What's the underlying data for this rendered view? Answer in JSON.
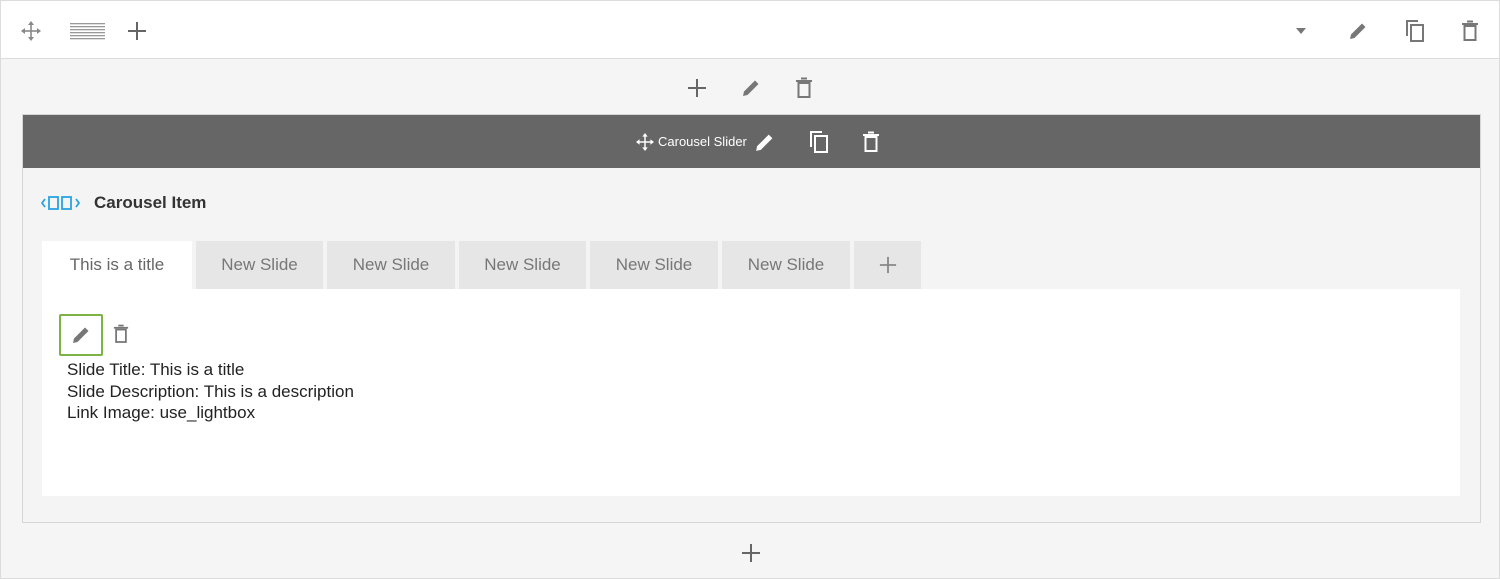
{
  "element": {
    "title": "Carousel Slider"
  },
  "carousel_item": {
    "label": "Carousel Item"
  },
  "tabs": [
    {
      "label": "This is a title",
      "active": true
    },
    {
      "label": "New Slide",
      "active": false
    },
    {
      "label": "New Slide",
      "active": false
    },
    {
      "label": "New Slide",
      "active": false
    },
    {
      "label": "New Slide",
      "active": false
    },
    {
      "label": "New Slide",
      "active": false
    }
  ],
  "slide": {
    "title_line": "Slide Title: This is a title",
    "description_line": "Slide Description: This is a description",
    "link_line": "Link Image: use_lightbox"
  },
  "icons": {
    "move": "move-icon",
    "layout": "row-layout-icon",
    "add": "plus-icon",
    "dropdown": "caret-down-icon",
    "edit": "pencil-icon",
    "clone": "copy-icon",
    "delete": "trash-icon",
    "carousel": "carousel-icon"
  },
  "colors": {
    "accent": "#29a3e0",
    "edit_border": "#7cb342",
    "element_bar": "#666666",
    "icon": "#777777"
  }
}
